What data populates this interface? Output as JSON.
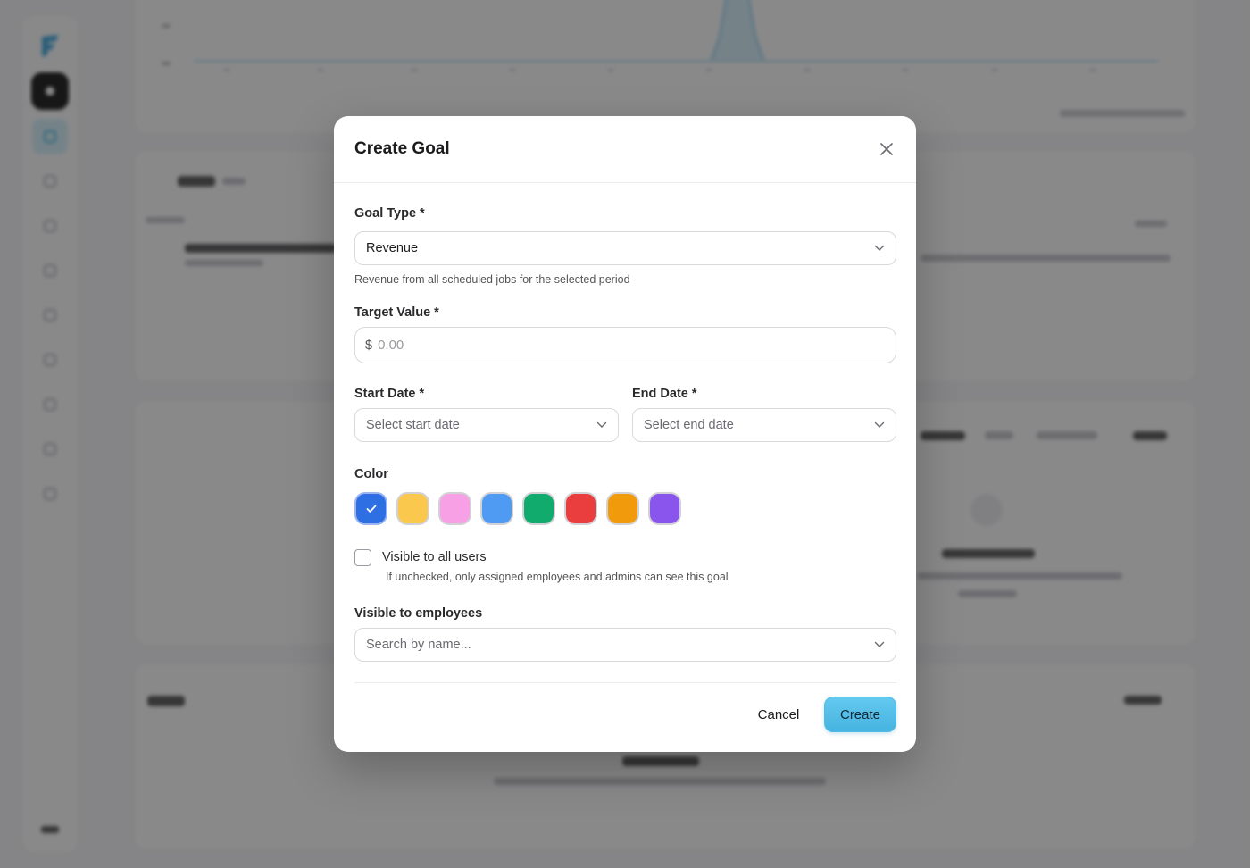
{
  "modal": {
    "title": "Create Goal",
    "goal_type": {
      "label": "Goal Type *",
      "value": "Revenue",
      "hint": "Revenue from all scheduled jobs for the selected period"
    },
    "target_value": {
      "label": "Target Value *",
      "prefix": "$",
      "placeholder": "0.00"
    },
    "start_date": {
      "label": "Start Date *",
      "placeholder": "Select start date"
    },
    "end_date": {
      "label": "End Date *",
      "placeholder": "Select end date"
    },
    "color": {
      "label": "Color",
      "swatches": [
        "#2f6fe4",
        "#f9c84d",
        "#f7a0e6",
        "#4f9bf4",
        "#12ab6e",
        "#ea3e3e",
        "#f19b0c",
        "#8a55ec"
      ],
      "selected_index": 0
    },
    "visibility": {
      "checkbox_label": "Visible to all users",
      "checked": false,
      "hint": "If unchecked, only assigned employees and admins can see this goal"
    },
    "employees": {
      "label": "Visible to employees",
      "placeholder": "Search by name..."
    },
    "actions": {
      "cancel": "Cancel",
      "create": "Create"
    }
  },
  "colors": {
    "accent": "#4fbbe6",
    "overlay": "#1c1c1e"
  }
}
